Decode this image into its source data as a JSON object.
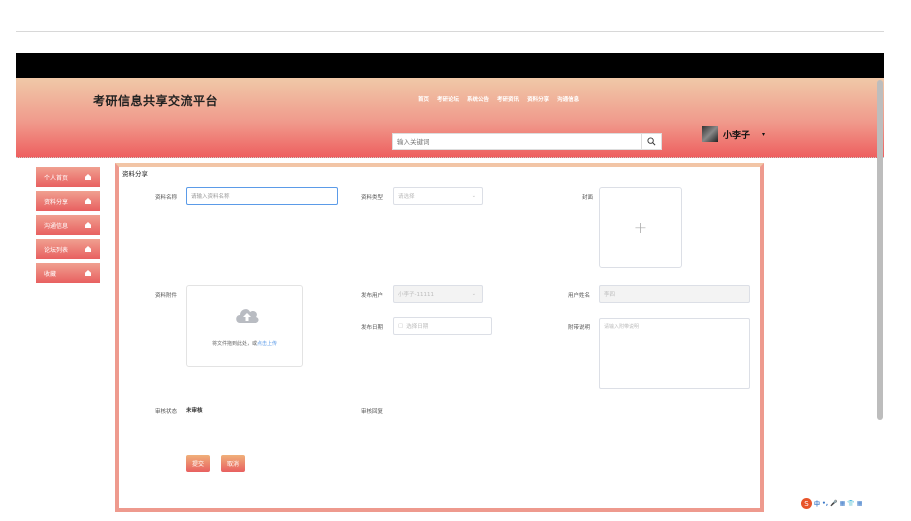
{
  "site": {
    "title": "考研信息共享交流平台"
  },
  "nav": [
    "首页",
    "考研论坛",
    "系统公告",
    "考研资讯",
    "资料分享",
    "沟通信息"
  ],
  "search": {
    "placeholder": "输入关键词"
  },
  "user": {
    "name": "小李子",
    "caret": "▾"
  },
  "sidebar": {
    "items": [
      {
        "label": "个人首页"
      },
      {
        "label": "资料分享"
      },
      {
        "label": "沟通信息"
      },
      {
        "label": "论坛列表"
      },
      {
        "label": "收藏"
      }
    ]
  },
  "form": {
    "title": "资料分享",
    "name_label": "资料名称",
    "name_placeholder": "请输入资料名称",
    "type_label": "资料类型",
    "type_placeholder": "请选择",
    "cover_label": "封面",
    "cover_plus": "+",
    "attachment_label": "资料附件",
    "upload_text": "将文件拖到此处，或",
    "upload_link": "点击上传",
    "publisher_label": "发布用户",
    "publisher_value": "小李子-11111",
    "username_label": "用户姓名",
    "username_value": "李四",
    "date_label": "发布日期",
    "date_placeholder": "选择日期",
    "note_label": "附带说明",
    "note_placeholder": "请输入附带说明",
    "status_label": "审核状态",
    "status_value": "未审核",
    "reply_label": "审核回复",
    "submit_label": "提交",
    "cancel_label": "取消"
  },
  "ime": {
    "logo": "S",
    "items": [
      "中",
      "•,",
      "🎤",
      "▦",
      "👕",
      "▦"
    ]
  },
  "colors": {
    "accent": "#e86060",
    "accent_light": "#f0c9a8",
    "link": "#5b9be8"
  }
}
